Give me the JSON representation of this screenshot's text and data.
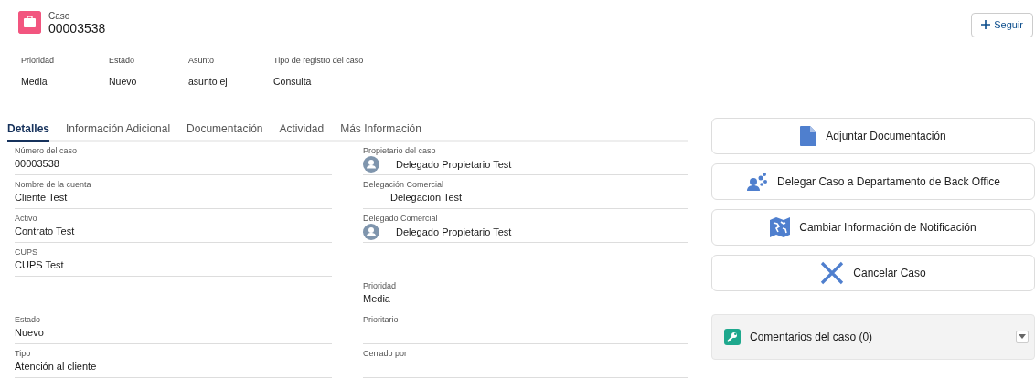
{
  "header": {
    "object_label": "Caso",
    "title": "00003538",
    "follow_button": "Seguir"
  },
  "highlights": [
    {
      "label": "Prioridad",
      "value": "Media"
    },
    {
      "label": "Estado",
      "value": "Nuevo"
    },
    {
      "label": "Asunto",
      "value": "asunto ej"
    },
    {
      "label": "Tipo de registro del caso",
      "value": "Consulta"
    }
  ],
  "tabs": [
    {
      "label": "Detalles",
      "selected": true
    },
    {
      "label": "Información Adicional",
      "selected": false
    },
    {
      "label": "Documentación",
      "selected": false
    },
    {
      "label": "Actividad",
      "selected": false
    },
    {
      "label": "Más Información",
      "selected": false
    }
  ],
  "details": [
    {
      "left": {
        "label": "Número del caso",
        "value": "00003538"
      },
      "right": {
        "label": "Propietario del caso",
        "value": "Delegado Propietario Test",
        "kind": "user"
      }
    },
    {
      "left": {
        "label": "Nombre de la cuenta",
        "value": "Cliente Test"
      },
      "right": {
        "label": "Delegación Comercial",
        "value": "Delegación Test",
        "kind": "indented"
      }
    },
    {
      "left": {
        "label": "Activo",
        "value": "Contrato Test"
      },
      "right": {
        "label": "Delegado Comercial",
        "value": "Delegado Propietario Test",
        "kind": "user"
      }
    },
    {
      "left": {
        "label": "CUPS",
        "value": "CUPS Test"
      }
    },
    {
      "right": {
        "label": "Prioridad",
        "value": "Media"
      }
    },
    {
      "left": {
        "label": "Estado",
        "value": "Nuevo"
      },
      "right": {
        "label": "Prioritario"
      }
    },
    {
      "left": {
        "label": "Tipo",
        "value": "Atención al cliente"
      },
      "right": {
        "label": "Cerrado por"
      }
    }
  ],
  "actions": [
    {
      "label": "Adjuntar Documentación",
      "kind": "document"
    },
    {
      "label": "Delegar Caso a Departamento de Back Office",
      "kind": "people"
    },
    {
      "label": "Cambiar Información de Notificación",
      "kind": "map"
    },
    {
      "label": "Cancelar Caso",
      "kind": "cancel"
    }
  ],
  "related": {
    "title": "Comentarios del caso (0)"
  }
}
